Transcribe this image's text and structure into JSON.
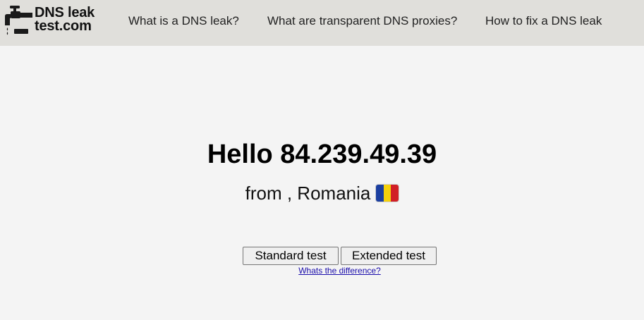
{
  "header": {
    "logo": {
      "line1": "DNS leak",
      "line2": "test.com",
      "icon": "faucet-icon"
    },
    "nav": [
      {
        "label": "What is a DNS leak?"
      },
      {
        "label": "What are transparent DNS proxies?"
      },
      {
        "label": "How to fix a DNS leak"
      }
    ]
  },
  "main": {
    "hello": "Hello 84.239.49.39",
    "from": "from , Romania",
    "flag": "romania-flag-icon",
    "buttons": {
      "standard": "Standard test",
      "extended": "Extended test"
    },
    "difference_link": "Whats the difference?"
  },
  "colors": {
    "header_bg": "#e0dfdb",
    "page_bg": "#f4f4f4",
    "link": "#1a0dab"
  }
}
